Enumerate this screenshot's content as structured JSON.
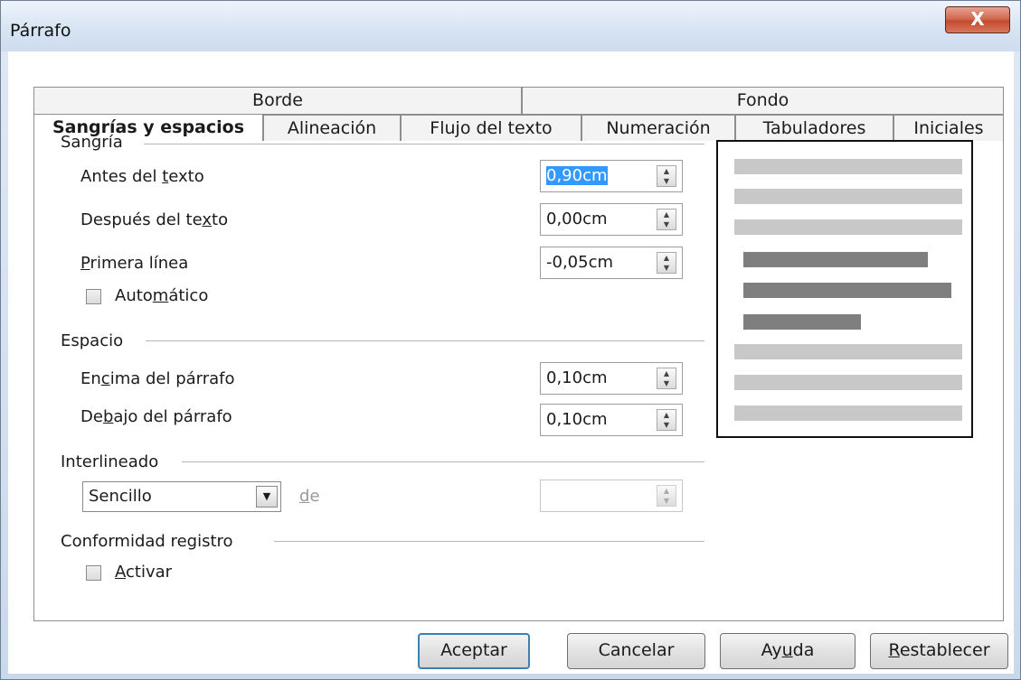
{
  "window": {
    "title": "Párrafo",
    "close_glyph": "X"
  },
  "tabs_top": [
    {
      "label": "Borde"
    },
    {
      "label": "Fondo"
    }
  ],
  "tabs": [
    {
      "label": "Sangrías y espacios",
      "active": true
    },
    {
      "label": "Alineación"
    },
    {
      "label": "Flujo del texto"
    },
    {
      "label": "Numeración"
    },
    {
      "label": "Tabuladores"
    },
    {
      "label": "Iniciales"
    }
  ],
  "sangria": {
    "heading": "Sangría",
    "antes": {
      "pre": "Antes del ",
      "acc": "t",
      "post": "exto",
      "value": "0,90cm"
    },
    "despues": {
      "pre": "Después del te",
      "acc": "x",
      "post": "to",
      "value": "0,00cm"
    },
    "primera": {
      "pre": "",
      "acc": "P",
      "post": "rimera línea",
      "value": "-0,05cm"
    },
    "automatico": {
      "pre": "Auto",
      "acc": "m",
      "post": "ático",
      "checked": false
    }
  },
  "espacio": {
    "heading": "Espacio",
    "encima": {
      "pre": "En",
      "acc": "c",
      "post": "ima del párrafo",
      "value": "0,10cm"
    },
    "debajo": {
      "pre": "De",
      "acc": "b",
      "post": "ajo del párrafo",
      "value": "0,10cm"
    }
  },
  "interlineado": {
    "heading": "Interlineado",
    "selected": "Sencillo",
    "de": {
      "pre": "",
      "acc": "d",
      "post": "e"
    },
    "value": ""
  },
  "registro": {
    "heading": "Conformidad registro",
    "activar": {
      "pre": "",
      "acc": "A",
      "post": "ctivar",
      "checked": false
    }
  },
  "buttons": {
    "aceptar": "Aceptar",
    "cancelar": "Cancelar",
    "ayuda": {
      "pre": "Ay",
      "acc": "u",
      "post": "da"
    },
    "restablecer": {
      "pre": "",
      "acc": "R",
      "post": "establecer"
    }
  },
  "colors": {
    "selection": "#3399ff",
    "preview_light": "#c8c8c8",
    "preview_dark": "#7f7f7f",
    "close_red": "#c44a2e"
  }
}
